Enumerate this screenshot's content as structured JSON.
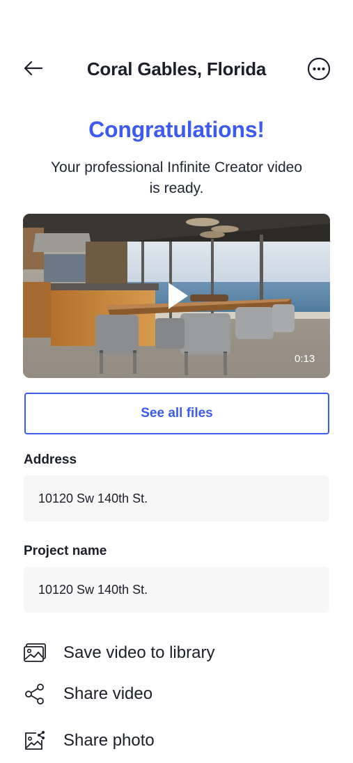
{
  "header": {
    "title": "Coral Gables, Florida",
    "back_icon": "arrow-left-icon",
    "more_icon": "more-horizontal-circle-icon"
  },
  "hero": {
    "heading": "Congratulations!",
    "message": "Your professional Infinite Creator video is ready."
  },
  "video": {
    "duration": "0:13",
    "play_icon": "play-icon"
  },
  "buttons": {
    "see_all_files": "See all files"
  },
  "fields": {
    "address": {
      "label": "Address",
      "value": "10120 Sw 140th St."
    },
    "project_name": {
      "label": "Project name",
      "value": "10120 Sw 140th St."
    }
  },
  "actions": [
    {
      "label": "Save video to library",
      "icon": "photo-library-icon"
    },
    {
      "label": "Share video",
      "icon": "share-icon"
    },
    {
      "label": "Share photo",
      "icon": "share-photo-icon"
    }
  ],
  "colors": {
    "accent": "#3d5af1",
    "text": "#1c1f2a",
    "field_bg": "#f7f7f8"
  }
}
